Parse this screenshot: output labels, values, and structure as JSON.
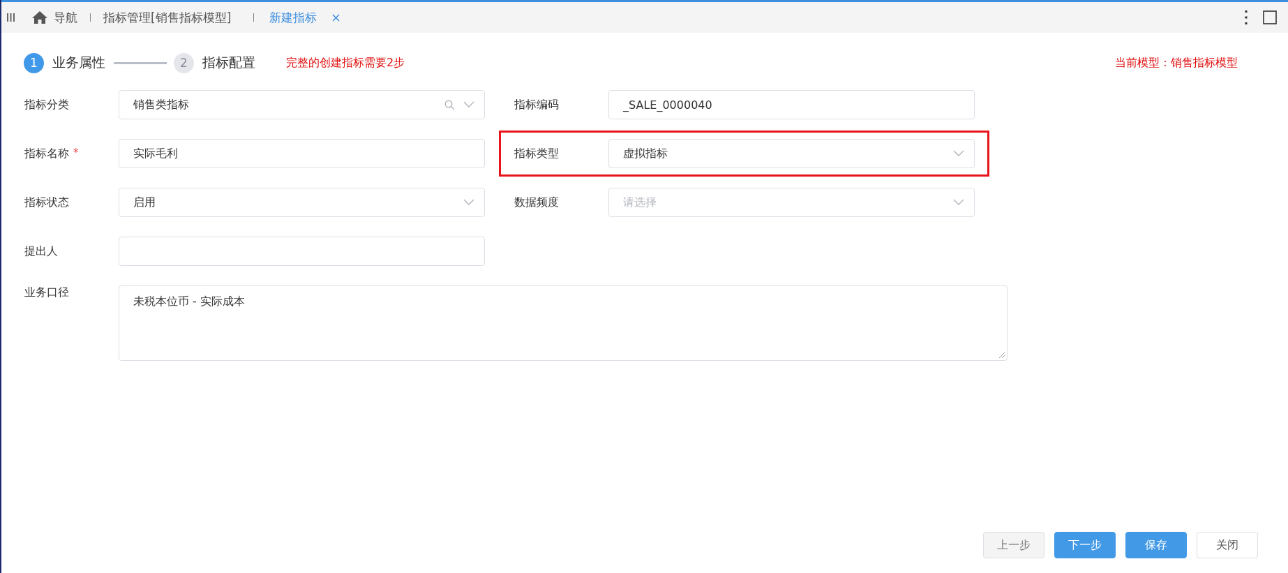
{
  "tabs": [
    {
      "label": "导航",
      "selected": false,
      "kind": "home"
    },
    {
      "label": "指标管理[销售指标模型]",
      "selected": false,
      "kind": "plain"
    },
    {
      "label": "新建指标",
      "selected": true,
      "kind": "closable"
    }
  ],
  "steps": [
    {
      "number": "1",
      "label": "业务属性",
      "selected": true
    },
    {
      "number": "2",
      "label": "指标配置",
      "selected": false
    }
  ],
  "step_note": "完整的创建指标需要2步",
  "current_model": "当前模型：销售指标模型",
  "fields": [
    {
      "label": "指标分类",
      "kind": "search-select",
      "value": "销售类指标",
      "highlighted": false
    },
    {
      "label": "指标编码",
      "kind": "text",
      "value": "_SALE_0000040",
      "highlighted": false
    },
    {
      "label": "指标名称",
      "kind": "text",
      "value": "实际毛利",
      "required_mark": "*",
      "highlighted": false
    },
    {
      "label": "指标类型",
      "kind": "select",
      "value": "虚拟指标",
      "highlighted": true
    },
    {
      "label": "指标状态",
      "kind": "select",
      "value": "启用",
      "highlighted": false
    },
    {
      "label": "数据频度",
      "kind": "select",
      "placeholder": "请选择",
      "highlighted": false
    },
    {
      "label": "提出人",
      "kind": "text",
      "highlighted": false
    }
  ],
  "textarea": {
    "label": "业务口径",
    "value": "未税本位币 - 实际成本"
  },
  "buttons": [
    {
      "label": "上一步",
      "kind": "default",
      "disabled": true
    },
    {
      "label": "下一步",
      "kind": "primary",
      "disabled": false
    },
    {
      "label": "保存",
      "kind": "primary",
      "disabled": false
    },
    {
      "label": "关闭",
      "kind": "default",
      "disabled": false
    }
  ]
}
